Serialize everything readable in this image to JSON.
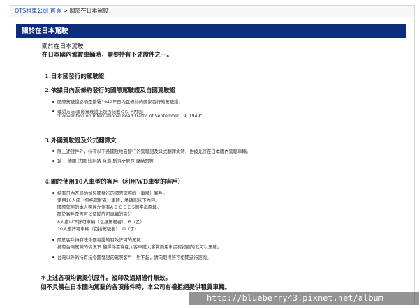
{
  "breadcrumb": {
    "site": "OTS租車公司 首頁",
    "separator": " > ",
    "current": "關於在日本駕駛"
  },
  "title": "關於在日本駕駛",
  "intro": {
    "line1": "關於在日本駕駛",
    "line2": "在日本國內駕駛車輛時，需要持有下述證件之一。"
  },
  "sections": {
    "s1": {
      "heading": "1.日本國發行的駕駛證"
    },
    "s2": {
      "heading": "2.依據日內瓦條約發行的國際駕駛證及自國駕駛證",
      "items": [
        "國際駕駛證必須是簽署1949年日內瓦條約的國家發行的駕駛證。",
        "確認方法:國際駕駛證上是否記載有以下內容:",
        "\"Convention on International Road Traffic of September 19, 1949\""
      ]
    },
    "s3": {
      "heading": "3.外國駕駛證及公式翻譯文",
      "items": [
        "除上述證件外，持有以下各國及地區發行的駕駛證及公式翻譯文時，也被允許在日本國內駕駛車輛。",
        "瑞士 德國 法國 比利時 台灣 斯洛文尼亞 摩納哥等"
      ]
    },
    "s4": {
      "heading": "4.關於使用10人車型的客戶（利用WD車型的客戶）",
      "items": [
        "持有日內瓦條約加盟國發行的國際駕照的（車牌）客戶。",
        "使用10人座（包括駕駛者）車時，請確認以下內容。",
        "國際駕照的本人照片左側有A B C C E 5個字母區域。",
        "關於客戶是否可以駕駛許可車輛的區分",
        "8人座以下許可車輛（包括駕駛者）：B（乙）",
        "10人座許可車輛（包括駕駛者）：D（丁）",
        "關於客戶持有法令國發證的有效許可的駕照",
        "持有台灣駕照的情況下 翻譯件需寫在大客車或大客貨兩用車旁有打圈的就可以駕駛。",
        "台灣以外的持有法令國發證的駕照客戶，對不起，請向取得許可相關進行諮詢。"
      ]
    }
  },
  "footer": {
    "line1": "＊上述各項均需提供原件。複印及過期證件無效。",
    "line2": "如不具備在日本國內駕駛的各項條件時，本公司有權拒絕提供租賃車輛。"
  },
  "watermark": "http://blueberry43.pixnet.net/album"
}
